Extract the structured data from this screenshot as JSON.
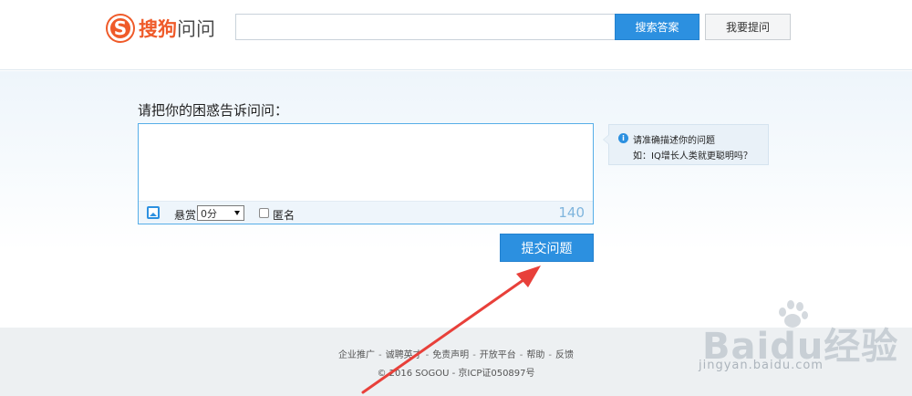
{
  "header": {
    "logo_letter": "S",
    "logo_brand": "搜狗",
    "logo_rest": "问问",
    "search_value": "",
    "search_button": "搜索答案",
    "ask_button": "我要提问"
  },
  "ask": {
    "prompt": "请把你的困惑告诉问问：",
    "textarea_value": "",
    "reward_label": "悬赏",
    "reward_value": "0分",
    "anonymous_label": "匿名",
    "char_count": "140",
    "submit_button": "提交问题"
  },
  "tip": {
    "icon_glyph": "i",
    "line1": "请准确描述你的问题",
    "line2": "如：IQ增长人类就更聪明吗？"
  },
  "footer": {
    "links": [
      "企业推广",
      "诚聘英才",
      "免责声明",
      "开放平台",
      "帮助",
      "反馈"
    ],
    "separators": [
      "-",
      "-",
      "-",
      "-",
      "-"
    ],
    "copyright": "© 2016 SOGOU - 京ICP证050897号"
  },
  "watermark": {
    "logo": "Baidu经验",
    "url": "jingyan.baidu.com"
  },
  "colors": {
    "accent": "#2c90e0",
    "brand": "#ef5a29",
    "annotation_arrow": "#e8403a"
  },
  "icons": {
    "logo": "sogou-s-logo",
    "image_upload": "image-icon",
    "select_caret": "caret-down-icon",
    "tip": "info-icon",
    "annotation": "red-arrow"
  }
}
